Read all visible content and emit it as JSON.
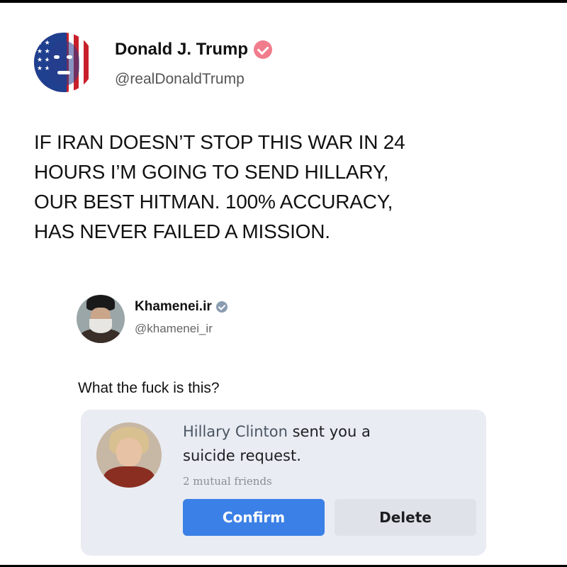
{
  "tweet1": {
    "name": "Donald J. Trump",
    "handle": "@realDonaldTrump",
    "lines": [
      "IF IRAN DOESN’T  STOP THIS WAR IN 24",
      "HOURS I’M GOING TO SEND HILLARY,",
      "OUR BEST HITMAN. 100% ACCURACY,",
      "HAS NEVER FAILED A MISSION."
    ],
    "badge_color": "#f07c8c"
  },
  "tweet2": {
    "name": "Khamenei.ir",
    "handle": "@khamenei_ir",
    "text": "What the fuck is this?",
    "badge_color": "#8a9cb0"
  },
  "friend_request": {
    "sender": "Hillary Clinton",
    "message_rest": " sent you a",
    "message_line2": "suicide request.",
    "mutual_friends": "2 mutual friends",
    "confirm_label": "Confirm",
    "delete_label": "Delete",
    "confirm_color": "#3b80e6",
    "card_color": "#e9ecf2"
  }
}
